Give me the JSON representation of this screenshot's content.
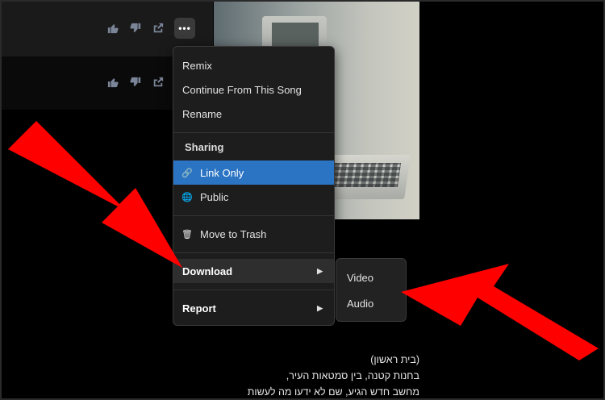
{
  "song_actions": {
    "like_icon": "thumbs-up-icon",
    "dislike_icon": "thumbs-down-icon",
    "share_icon": "share-icon",
    "more_label": "•••"
  },
  "menu": {
    "remix": "Remix",
    "continue": "Continue From This Song",
    "rename": "Rename",
    "sharing_header": "Sharing",
    "link_only": "Link Only",
    "public": "Public",
    "trash": "Move to Trash",
    "download": "Download",
    "report": "Report"
  },
  "submenu": {
    "video": "Video",
    "audio": "Audio"
  },
  "lyrics": {
    "line1": "(בית ראשון)",
    "line2": "בחנות קטנה, בין סמטאות העיר,",
    "line3": "מחשב חדש הגיע, שם לא ידעו מה לעשות"
  },
  "colors": {
    "annotation_arrow": "#ff0000",
    "active_item": "#2b74c3"
  }
}
